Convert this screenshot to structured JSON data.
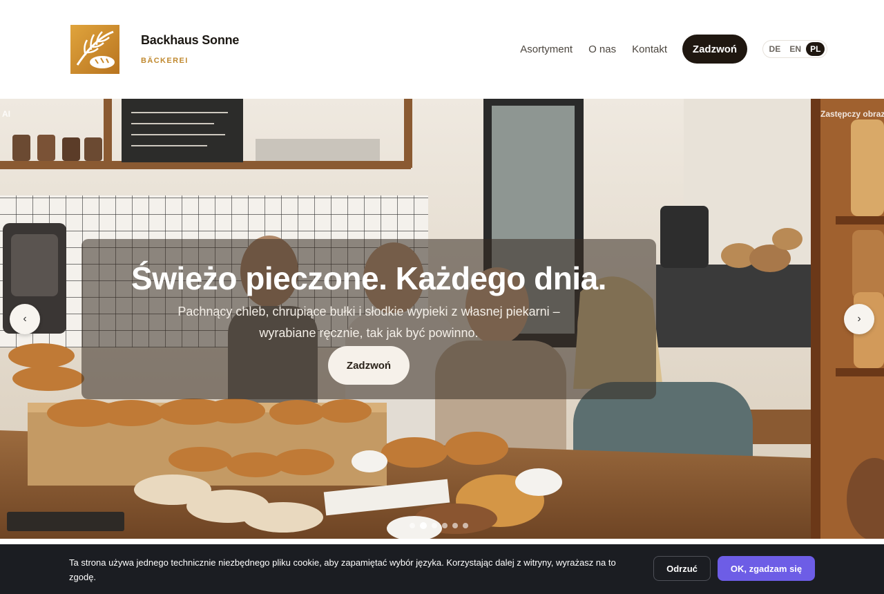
{
  "brand": {
    "name": "Backhaus Sonne",
    "subtitle": "BÄCKEREI",
    "logo_icon": "wheat-bread-logo-icon",
    "accent": "#c0892f"
  },
  "nav": {
    "items": [
      "Asortyment",
      "O nas",
      "Kontakt"
    ],
    "call_label": "Zadzwoń"
  },
  "lang": {
    "options": [
      "DE",
      "EN",
      "PL"
    ],
    "active": "PL"
  },
  "hero": {
    "ai_tag": "AI",
    "placeholder_tag": "Zastępczy obraz",
    "title": "Świeżo pieczone. Każdego dnia.",
    "text": "Pachnący chleb, chrupiące bułki i słodkie wypieki z własnej piekarni – wyrabiane ręcznie, tak jak być powinno.",
    "cta_label": "Zadzwoń",
    "prev_label": "‹",
    "next_label": "›",
    "slide_count": 6,
    "active_slide": 2
  },
  "cookie": {
    "text": "Ta strona używa jednego technicznie niezbędnego pliku cookie, aby zapamiętać wybór języka. Korzystając dalej z witryny, wyrażasz na to zgodę.",
    "decline_label": "Odrzuć",
    "accept_label": "OK, zgadzam się",
    "accept_color": "#6d5de6"
  }
}
